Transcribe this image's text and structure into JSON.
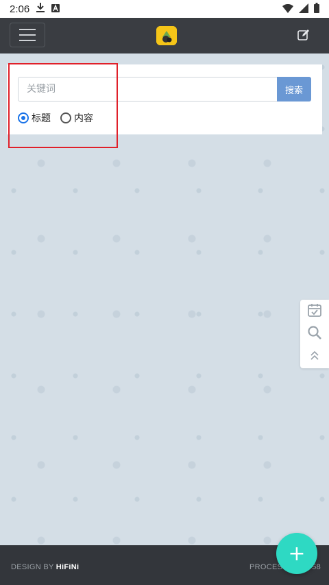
{
  "status_bar": {
    "time": "2:06",
    "icons": [
      "download-icon",
      "notification-a-icon",
      "wifi-icon",
      "signal-icon",
      "battery-icon"
    ]
  },
  "navbar": {
    "menu_icon": "hamburger-icon",
    "logo_icon": "hifini-logo",
    "edit_icon": "edit-icon"
  },
  "search": {
    "placeholder": "关键词",
    "value": "",
    "button_label": "搜索",
    "options": [
      {
        "label": "标题",
        "checked": true
      },
      {
        "label": "内容",
        "checked": false
      }
    ]
  },
  "side_tools": {
    "items": [
      "calendar-check-icon",
      "search-icon",
      "double-chevron-up-icon"
    ]
  },
  "footer": {
    "design_prefix": "DESIGN BY",
    "brand": "HiFiNi",
    "processed": "PROCESS",
    "processed_suffix": "58"
  },
  "fab": {
    "label": "+"
  },
  "colors": {
    "navbar_bg": "#3a3d42",
    "search_button": "#6a98d4",
    "fab": "#2ed9c3",
    "radio_checked": "#1a73e8",
    "highlight_border": "#e0202a"
  }
}
